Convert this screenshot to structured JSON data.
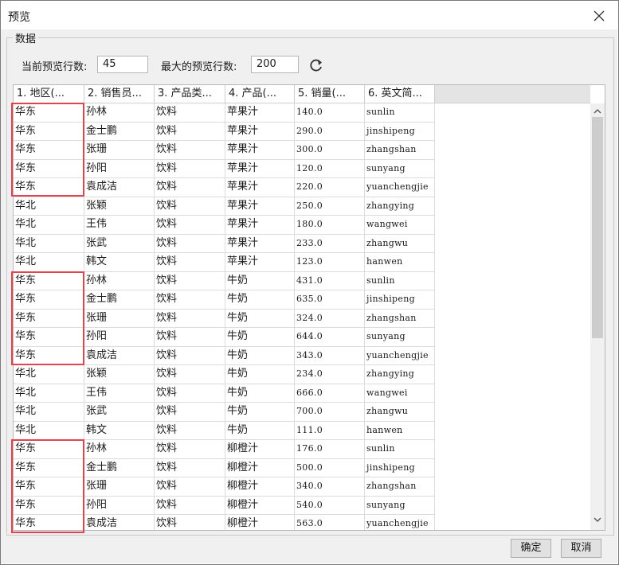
{
  "window": {
    "title": "预览"
  },
  "group": {
    "title": "数据"
  },
  "controls": {
    "current_rows_label": "当前预览行数:",
    "current_rows_value": "45",
    "max_rows_label": "最大的预览行数:",
    "max_rows_value": "200"
  },
  "table": {
    "headers": [
      "1. 地区(...",
      "2. 销售员...",
      "3. 产品类...",
      "4. 产品(...",
      "5. 销量(...",
      "6. 英文简..."
    ],
    "rows": [
      [
        "华东",
        "孙林",
        "饮料",
        "苹果汁",
        "140.0",
        "sunlin"
      ],
      [
        "华东",
        "金士鹏",
        "饮料",
        "苹果汁",
        "290.0",
        "jinshipeng"
      ],
      [
        "华东",
        "张珊",
        "饮料",
        "苹果汁",
        "300.0",
        "zhangshan"
      ],
      [
        "华东",
        "孙阳",
        "饮料",
        "苹果汁",
        "120.0",
        "sunyang"
      ],
      [
        "华东",
        "袁成洁",
        "饮料",
        "苹果汁",
        "220.0",
        "yuanchengjie"
      ],
      [
        "华北",
        "张颖",
        "饮料",
        "苹果汁",
        "250.0",
        "zhangying"
      ],
      [
        "华北",
        "王伟",
        "饮料",
        "苹果汁",
        "180.0",
        "wangwei"
      ],
      [
        "华北",
        "张武",
        "饮料",
        "苹果汁",
        "233.0",
        "zhangwu"
      ],
      [
        "华北",
        "韩文",
        "饮料",
        "苹果汁",
        "123.0",
        "hanwen"
      ],
      [
        "华东",
        "孙林",
        "饮料",
        "牛奶",
        "431.0",
        "sunlin"
      ],
      [
        "华东",
        "金士鹏",
        "饮料",
        "牛奶",
        "635.0",
        "jinshipeng"
      ],
      [
        "华东",
        "张珊",
        "饮料",
        "牛奶",
        "324.0",
        "zhangshan"
      ],
      [
        "华东",
        "孙阳",
        "饮料",
        "牛奶",
        "644.0",
        "sunyang"
      ],
      [
        "华东",
        "袁成洁",
        "饮料",
        "牛奶",
        "343.0",
        "yuanchengjie"
      ],
      [
        "华北",
        "张颖",
        "饮料",
        "牛奶",
        "234.0",
        "zhangying"
      ],
      [
        "华北",
        "王伟",
        "饮料",
        "牛奶",
        "666.0",
        "wangwei"
      ],
      [
        "华北",
        "张武",
        "饮料",
        "牛奶",
        "700.0",
        "zhangwu"
      ],
      [
        "华北",
        "韩文",
        "饮料",
        "牛奶",
        "111.0",
        "hanwen"
      ],
      [
        "华东",
        "孙林",
        "饮料",
        "柳橙汁",
        "176.0",
        "sunlin"
      ],
      [
        "华东",
        "金士鹏",
        "饮料",
        "柳橙汁",
        "500.0",
        "jinshipeng"
      ],
      [
        "华东",
        "张珊",
        "饮料",
        "柳橙汁",
        "340.0",
        "zhangshan"
      ],
      [
        "华东",
        "孙阳",
        "饮料",
        "柳橙汁",
        "540.0",
        "sunyang"
      ],
      [
        "华东",
        "袁成洁",
        "饮料",
        "柳橙汁",
        "563.0",
        "yuanchengjie"
      ]
    ]
  },
  "buttons": {
    "ok": "确定",
    "cancel": "取消"
  },
  "icons": {
    "close": "close-icon",
    "refresh": "refresh-icon",
    "scroll_up": "chevron-up-icon",
    "scroll_down": "chevron-down-icon"
  },
  "colors": {
    "highlight": "#e0454e",
    "dialog_bg": "#f0f0f0"
  }
}
